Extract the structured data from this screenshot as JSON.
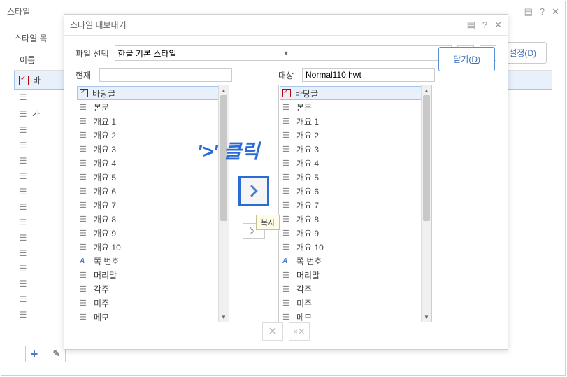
{
  "bg": {
    "title": "스타일",
    "list_label": "스타일 목",
    "col_name": "이름",
    "items": [
      {
        "icon": "check",
        "label": "바"
      },
      {
        "icon": "para",
        "label": ""
      },
      {
        "icon": "para",
        "label": "가"
      },
      {
        "icon": "para",
        "label": ""
      },
      {
        "icon": "para",
        "label": ""
      },
      {
        "icon": "para",
        "label": ""
      },
      {
        "icon": "para",
        "label": ""
      },
      {
        "icon": "para",
        "label": ""
      },
      {
        "icon": "para",
        "label": ""
      },
      {
        "icon": "para",
        "label": ""
      },
      {
        "icon": "para",
        "label": ""
      },
      {
        "icon": "para",
        "label": ""
      },
      {
        "icon": "para",
        "label": ""
      },
      {
        "icon": "para",
        "label": ""
      },
      {
        "icon": "para",
        "label": ""
      },
      {
        "icon": "para",
        "label": ""
      }
    ],
    "settings_label": "설정",
    "settings_key": "D"
  },
  "fg": {
    "title": "스타일 내보내기",
    "file_label": "파일 선택",
    "file_value": "한글 기본 스타일",
    "current_label": "현재",
    "current_value": "",
    "target_label": "대상",
    "target_value": "Normal110.hwt",
    "close_label": "닫기",
    "close_key": "D",
    "tooltip": "복사",
    "annotation": "'>' 클릭",
    "left_items": [
      {
        "icon": "check",
        "label": "바탕글",
        "sel": true
      },
      {
        "icon": "para",
        "label": "본문"
      },
      {
        "icon": "para",
        "label": "개요 1"
      },
      {
        "icon": "para",
        "label": "개요 2"
      },
      {
        "icon": "para",
        "label": "개요 3"
      },
      {
        "icon": "para",
        "label": "개요 4"
      },
      {
        "icon": "para",
        "label": "개요 5"
      },
      {
        "icon": "para",
        "label": "개요 6"
      },
      {
        "icon": "para",
        "label": "개요 7"
      },
      {
        "icon": "para",
        "label": "개요 8"
      },
      {
        "icon": "para",
        "label": "개요 9"
      },
      {
        "icon": "para",
        "label": "개요 10"
      },
      {
        "icon": "aa",
        "label": "쪽 번호"
      },
      {
        "icon": "para",
        "label": "머리말"
      },
      {
        "icon": "para",
        "label": "각주"
      },
      {
        "icon": "para",
        "label": "미주"
      },
      {
        "icon": "para",
        "label": "메모"
      }
    ],
    "right_items": [
      {
        "icon": "check",
        "label": "바탕글",
        "sel": true
      },
      {
        "icon": "para",
        "label": "본문"
      },
      {
        "icon": "para",
        "label": "개요 1"
      },
      {
        "icon": "para",
        "label": "개요 2"
      },
      {
        "icon": "para",
        "label": "개요 3"
      },
      {
        "icon": "para",
        "label": "개요 4"
      },
      {
        "icon": "para",
        "label": "개요 5"
      },
      {
        "icon": "para",
        "label": "개요 6"
      },
      {
        "icon": "para",
        "label": "개요 7"
      },
      {
        "icon": "para",
        "label": "개요 8"
      },
      {
        "icon": "para",
        "label": "개요 9"
      },
      {
        "icon": "para",
        "label": "개요 10"
      },
      {
        "icon": "aa",
        "label": "쪽 번호"
      },
      {
        "icon": "para",
        "label": "머리말"
      },
      {
        "icon": "para",
        "label": "각주"
      },
      {
        "icon": "para",
        "label": "미주"
      },
      {
        "icon": "para",
        "label": "메모"
      }
    ]
  }
}
